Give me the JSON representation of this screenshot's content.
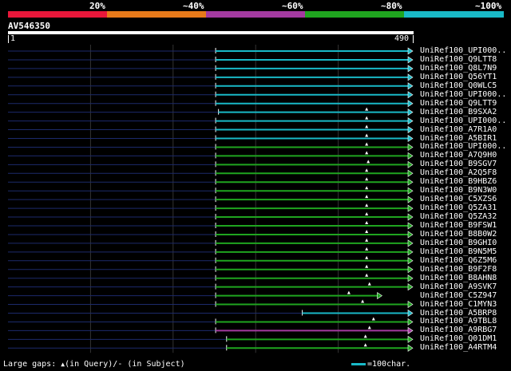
{
  "legend": {
    "segments": [
      "#e8173a",
      "#e87a1a",
      "#a33aa0",
      "#1fa51f",
      "#19b9c7"
    ],
    "labels": [
      "20%",
      "~40%",
      "~60%",
      "~80%",
      "~100%"
    ]
  },
  "query": {
    "name": "AV546350",
    "start": "1",
    "end": "490"
  },
  "hits": [
    {
      "label": "UniRef100_UPI000..",
      "start": 0.513,
      "color": "#19b9c7",
      "gap": null
    },
    {
      "label": "UniRef100_Q9LTT8",
      "start": 0.513,
      "color": "#19b9c7",
      "gap": null
    },
    {
      "label": "UniRef100_Q8L7N9",
      "start": 0.513,
      "color": "#19b9c7",
      "gap": null
    },
    {
      "label": "UniRef100_Q56YT1",
      "start": 0.513,
      "color": "#19b9c7",
      "gap": null
    },
    {
      "label": "UniRef100_Q0WLC5",
      "start": 0.513,
      "color": "#19b9c7",
      "gap": null
    },
    {
      "label": "UniRef100_UPI000..",
      "start": 0.513,
      "color": "#19b9c7",
      "gap": null
    },
    {
      "label": "UniRef100_Q9LTT9",
      "start": 0.513,
      "color": "#19b9c7",
      "gap": null
    },
    {
      "label": "UniRef100_B9SXA2",
      "start": 0.52,
      "color": "#19b9c7",
      "gap": 0.886
    },
    {
      "label": "UniRef100_UPI000..",
      "start": 0.513,
      "color": "#19b9c7",
      "gap": 0.886
    },
    {
      "label": "UniRef100_A7R1A0",
      "start": 0.513,
      "color": "#19b9c7",
      "gap": 0.886
    },
    {
      "label": "UniRef100_A5BIR1",
      "start": 0.513,
      "color": "#19b9c7",
      "gap": 0.886
    },
    {
      "label": "UniRef100_UPI000..",
      "start": 0.513,
      "color": "#1fa51f",
      "gap": 0.886
    },
    {
      "label": "UniRef100_A7Q9H0",
      "start": 0.513,
      "color": "#1fa51f",
      "gap": 0.886
    },
    {
      "label": "UniRef100_B9SGV7",
      "start": 0.513,
      "color": "#1fa51f",
      "gap": 0.89
    },
    {
      "label": "UniRef100_A2Q5F8",
      "start": 0.513,
      "color": "#1fa51f",
      "gap": 0.886
    },
    {
      "label": "UniRef100_B9HBZ6",
      "start": 0.513,
      "color": "#1fa51f",
      "gap": 0.886
    },
    {
      "label": "UniRef100_B9N3W0",
      "start": 0.513,
      "color": "#1fa51f",
      "gap": 0.886
    },
    {
      "label": "UniRef100_C5XZS6",
      "start": 0.513,
      "color": "#1fa51f",
      "gap": 0.886
    },
    {
      "label": "UniRef100_Q5ZA31",
      "start": 0.513,
      "color": "#1fa51f",
      "gap": 0.886
    },
    {
      "label": "UniRef100_Q5ZA32",
      "start": 0.513,
      "color": "#1fa51f",
      "gap": 0.886
    },
    {
      "label": "UniRef100_B9FSW1",
      "start": 0.513,
      "color": "#1fa51f",
      "gap": 0.886
    },
    {
      "label": "UniRef100_B8B0W2",
      "start": 0.513,
      "color": "#1fa51f",
      "gap": 0.886
    },
    {
      "label": "UniRef100_B9GHI0",
      "start": 0.513,
      "color": "#1fa51f",
      "gap": 0.886
    },
    {
      "label": "UniRef100_B9N5M5",
      "start": 0.513,
      "color": "#1fa51f",
      "gap": 0.886
    },
    {
      "label": "UniRef100_Q6Z5M6",
      "start": 0.513,
      "color": "#1fa51f",
      "gap": 0.886
    },
    {
      "label": "UniRef100_B9F2F8",
      "start": 0.513,
      "color": "#1fa51f",
      "gap": 0.886
    },
    {
      "label": "UniRef100_B8AHN8",
      "start": 0.513,
      "color": "#1fa51f",
      "gap": 0.886
    },
    {
      "label": "UniRef100_A9SVK7",
      "start": 0.513,
      "color": "#1fa51f",
      "gap": 0.893
    },
    {
      "label": "UniRef100_C5Z947",
      "start": 0.513,
      "color": "#1fa51f",
      "end": 0.924,
      "gap": 0.842
    },
    {
      "label": "UniRef100_C1MYN3",
      "start": 0.513,
      "color": "#1fa51f",
      "gap": 0.876
    },
    {
      "label": "UniRef100_A5BRP8",
      "start": 0.727,
      "color": "#19b9c7",
      "gap": null
    },
    {
      "label": "UniRef100_A9TBL8",
      "start": 0.513,
      "color": "#1fa51f",
      "gap": 0.903
    },
    {
      "label": "UniRef100_A9RBG7",
      "start": 0.513,
      "color": "#a33aa0",
      "gap": 0.893
    },
    {
      "label": "UniRef100_Q01DM1",
      "start": 0.54,
      "color": "#1fa51f",
      "gap": 0.883
    },
    {
      "label": "UniRef100_A4RTM4",
      "start": 0.54,
      "color": "#1fa51f",
      "gap": 0.883
    }
  ],
  "footer": {
    "gaps_label": "Large gaps:",
    "gaps_query": "(in Query)/",
    "gaps_subject": "- (in Subject)",
    "scale_text": "=100char.",
    "scale_color": "#19b9c7"
  }
}
